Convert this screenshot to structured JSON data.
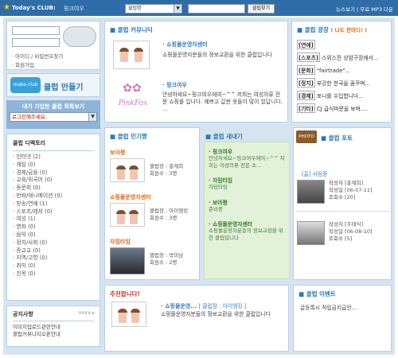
{
  "topbar": {
    "brand": "Today's CLUB:",
    "current": "핑크여우",
    "search_select": "클럽명",
    "search_button": "클럽찾기",
    "links": "뉴스보기 | 무료 MP3 다운"
  },
  "login": {
    "find_link": "· 아이디 / 비밀번호찾기",
    "join_link": "· 회원가입"
  },
  "make_club": {
    "tag": "make club",
    "label": "클럽 만들기"
  },
  "my_clubs": {
    "header": "내가 가입한 클럽 목록보기",
    "select_value": "로그인해주세요."
  },
  "directory": {
    "title": "클럽 디렉토리",
    "items": [
      "· 인터넷 (2)",
      "· 게임 (0)",
      "· 경제/금융 (0)",
      "· 교육/외국어 (0)",
      "· 동문회 (0)",
      "· 만화/애니메이션 (0)",
      "· 방송/연예 (1)",
      "· 스포츠/레저 (0)",
      "· 여성 (1)",
      "· 영화 (0)",
      "· 음악 (0)",
      "· 정치/사회 (0)",
      "· 종교교 (0)",
      "· 지역/고향 (0)",
      "· 취미 (0)",
      "· 친목 (0)"
    ]
  },
  "notice": {
    "title": "공지사항",
    "more": "more ▸",
    "items": [
      "이미지업로드관련안내",
      "클럽커뮤니티오픈안내"
    ]
  },
  "community": {
    "title": "클럽 커뮤니티",
    "c1_name": "· 쇼핑몰운영자센터",
    "c1_desc": "쇼핑몰운영자분들의 정보교환을 위한 클럽입니다",
    "c2_name": "· 핑크여우",
    "c2_desc": "안녕하세요~핑크여우에여~^^ 저희는 여성의류 전문 쇼핑몰 입니다. 예쁘고 값싼 옷들이 많이 있답니다. ...",
    "c2_logo": "PinkFox"
  },
  "plaza": {
    "title": "클럽 광장",
    "subtitle": "( 나도 한마디! )",
    "rows": [
      {
        "tag": "[연예]",
        "text": ""
      },
      {
        "tag": "[스포츠]",
        "text": "스위스전 상암구장에서..."
      },
      {
        "tag": "[문화]",
        "text": "\"fairtrade\"..."
      },
      {
        "tag": "[정치]",
        "text": "부강한 한국을 꿈꾸며..."
      },
      {
        "tag": "[경제]",
        "text": "포니를 수입합니다..."
      },
      {
        "tag": "[기타]",
        "text": "CJ 급식파문을 보며...."
      }
    ]
  },
  "popular": {
    "title": "클럽 인기짱",
    "clubs": [
      {
        "name": "보아짱",
        "leader": "클럽장 : 홍재희",
        "members": "회원수 : 3명"
      },
      {
        "name": "쇼핑몰운영자센터",
        "leader": "클럽장 : 아이엠킹",
        "members": "회원수 : 3명"
      },
      {
        "name": "자밈타임",
        "leader": "클럽장 : 박미남",
        "members": "회원수 : 2명"
      }
    ]
  },
  "newcomers": {
    "title": "클럽 새내기",
    "clubs": [
      {
        "name": "· 핑크여우",
        "desc": "안녕하세요~핑크여우에여~^^ 저희는 여성의류 전문 쇼..."
      },
      {
        "name": "· 자밈타임",
        "desc": "자밈타임"
      },
      {
        "name": "· 보아짱",
        "desc": "준비중"
      },
      {
        "name": "· 쇼핑몰운영자센터",
        "desc": "쇼핑몰운영자분들의 정보교환을 위한 클럽입니다"
      }
    ]
  },
  "photo": {
    "title": "클럽 포토",
    "badge": "PHOTO",
    "club": "[흠] 사림중",
    "posts": [
      {
        "author": "작성자 [홍재희]",
        "date": "작성일 [06-07-11]",
        "views": "조회수 [20]"
      },
      {
        "author": "작성자 [주태식]",
        "date": "작성일 [06-08-10]",
        "views": "조회수 [5]"
      }
    ]
  },
  "recommend": {
    "title": "추천합니다!",
    "name": "· 쇼핑몰운영...",
    "leader": "[ 클럽장 : 아이엠킹 ]",
    "desc": "쇼핑몰운영자분들의 정보교환을 위한 클럽입니다"
  },
  "events": {
    "title": "클럽 이벤트",
    "text": "글등록시 적립금지급안..."
  }
}
